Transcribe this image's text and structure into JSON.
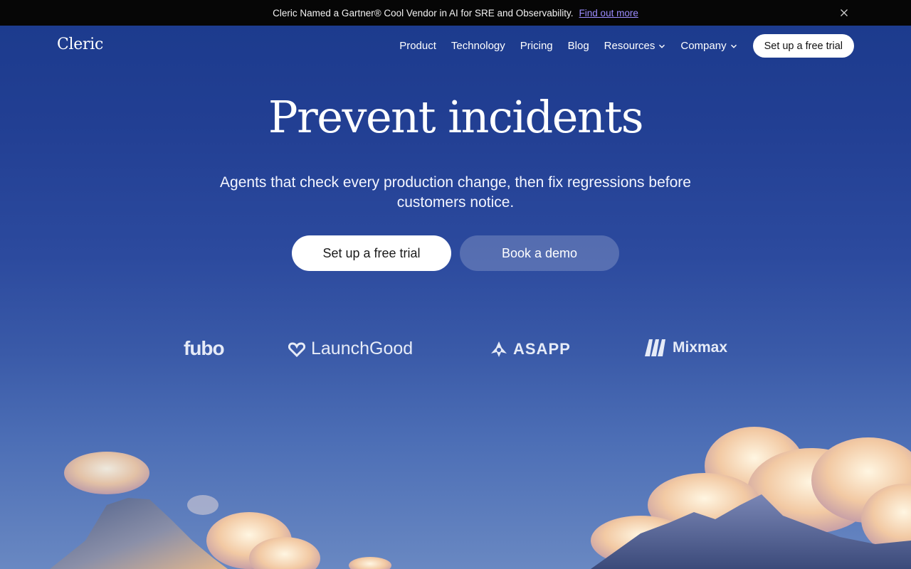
{
  "announcement": {
    "text": "Cleric Named a Gartner® Cool Vendor in AI for SRE and Observability.",
    "link_label": "Find out more",
    "close_icon": "close-icon",
    "link_color": "#9c8cff"
  },
  "nav": {
    "logo": "Cleric",
    "items": [
      {
        "label": "Product"
      },
      {
        "label": "Technology"
      },
      {
        "label": "Pricing"
      },
      {
        "label": "Blog"
      },
      {
        "label": "Resources",
        "icon": "chevron-down-icon"
      },
      {
        "label": "Company",
        "icon": "chevron-down-icon"
      }
    ],
    "cta_label": "Set up a free trial"
  },
  "hero": {
    "title": "Prevent incidents",
    "subtitle": "Agents that check every production change, then fix regressions before customers notice.",
    "primary_label": "Set up a free trial",
    "secondary_label": "Book a demo"
  },
  "customers": [
    {
      "name": "fubo"
    },
    {
      "name": "LaunchGood",
      "icon": "heart-icon"
    },
    {
      "name": "ASAPP",
      "icon": "asapp-mark-icon"
    },
    {
      "name": "Mixmax",
      "icon": "mixmax-mark-icon"
    }
  ],
  "theme": {
    "bg_top": "#1b3a8c",
    "bg_bottom": "#6988c2",
    "announcement_bg": "#060606"
  }
}
